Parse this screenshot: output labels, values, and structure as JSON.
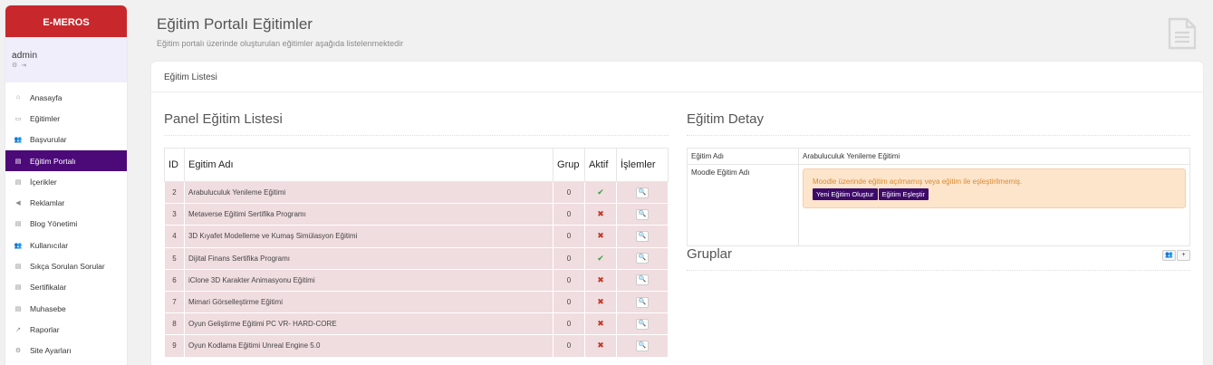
{
  "brand": "E-MEROS",
  "user": {
    "name": "admin",
    "icons": [
      "gear-icon",
      "logout-icon"
    ]
  },
  "menu": [
    {
      "label": "Anasayfa",
      "icon": "home-icon",
      "glyph": "⌂"
    },
    {
      "label": "Eğitimler",
      "icon": "book-icon",
      "glyph": "▭"
    },
    {
      "label": "Başvurular",
      "icon": "users-icon",
      "glyph": "👥"
    },
    {
      "label": "Eğitim Portalı",
      "icon": "file-icon",
      "glyph": "▤",
      "active": true
    },
    {
      "label": "İçerikler",
      "icon": "file-text-icon",
      "glyph": "▤"
    },
    {
      "label": "Reklamlar",
      "icon": "bullhorn-icon",
      "glyph": "◀"
    },
    {
      "label": "Blog Yönetimi",
      "icon": "file-icon",
      "glyph": "▤"
    },
    {
      "label": "Kullanıcılar",
      "icon": "users-icon",
      "glyph": "👥"
    },
    {
      "label": "Sıkça Sorulan Sorular",
      "icon": "file-icon",
      "glyph": "▤"
    },
    {
      "label": "Sertifikalar",
      "icon": "file-icon",
      "glyph": "▤"
    },
    {
      "label": "Muhasebe",
      "icon": "file-icon",
      "glyph": "▤"
    },
    {
      "label": "Raporlar",
      "icon": "chart-icon",
      "glyph": "↗"
    },
    {
      "label": "Site Ayarları",
      "icon": "gear-icon",
      "glyph": "⚙"
    }
  ],
  "header": {
    "title": "Eğitim Portalı Eğitimler",
    "subtitle": "Eğitim portalı üzerinde oluşturulan eğitimler aşağıda listelenmektedir"
  },
  "card": {
    "tab": "Eğitim Listesi"
  },
  "left": {
    "title": "Panel Eğitim Listesi",
    "columns": [
      "ID",
      "Egitim Adı",
      "Grup",
      "Aktif",
      "İşlemler"
    ],
    "rows": [
      {
        "id": "2",
        "name": "Arabuluculuk Yenileme Eğitimi",
        "group": "0",
        "active": true
      },
      {
        "id": "3",
        "name": "Metaverse Eğitimi Sertifika Programı",
        "group": "0",
        "active": false
      },
      {
        "id": "4",
        "name": "3D Kıyafet Modelleme ve Kumaş Simülasyon Eğitimi",
        "group": "0",
        "active": false
      },
      {
        "id": "5",
        "name": "Dijital Finans Sertifika Programı",
        "group": "0",
        "active": true
      },
      {
        "id": "6",
        "name": "iClone 3D Karakter Animasyonu Eğitimi",
        "group": "0",
        "active": false
      },
      {
        "id": "7",
        "name": "Mimari Görselleştirme Eğitimi",
        "group": "0",
        "active": false
      },
      {
        "id": "8",
        "name": "Oyun Geliştirme Eğitimi PC VR- HARD-CORE",
        "group": "0",
        "active": false
      },
      {
        "id": "9",
        "name": "Oyun Kodlama Eğitimi Unreal Engine 5.0",
        "group": "0",
        "active": false
      }
    ]
  },
  "right": {
    "title": "Eğitim Detay",
    "name_label": "Eğitim Adı",
    "name_value": "Arabuluculuk Yenileme Eğitimi",
    "moodle_label": "Moodle Eğitim Adı",
    "alert": "Moodle üzerinde eğitim açılmamış veya eğitim ile eşleştirilmemiş.",
    "btn_create": "Yeni Eğitim Oluştur",
    "btn_match": "Eğitim Eşleştir",
    "groups_title": "Gruplar"
  },
  "colors": {
    "brand": "#c8282c",
    "active": "#4b0a78",
    "row": "#f0dde0",
    "alert": "#fde5cc"
  }
}
